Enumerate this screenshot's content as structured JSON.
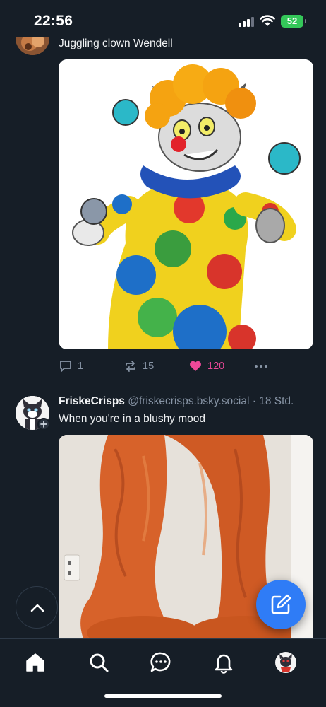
{
  "status_bar": {
    "time": "22:56",
    "battery": "52"
  },
  "posts": [
    {
      "text": "Juggling clown Wendell",
      "stats": {
        "replies": "1",
        "reposts": "15",
        "likes": "120"
      }
    },
    {
      "author_name": "FriskeCrisps",
      "author_handle": "@friskecrisps.bsky.social",
      "separator": "·",
      "time_ago": "18 Std.",
      "text": "When you're in a blushy mood"
    }
  ],
  "colors": {
    "background": "#161e27",
    "accent": "#2f7cf6",
    "like": "#ec4899",
    "muted": "#8895a6"
  },
  "icons": [
    "home-icon",
    "search-icon",
    "chat-icon",
    "bell-icon",
    "compose-icon",
    "chevron-up-icon",
    "reply-icon",
    "repost-icon",
    "heart-icon",
    "more-icon"
  ]
}
